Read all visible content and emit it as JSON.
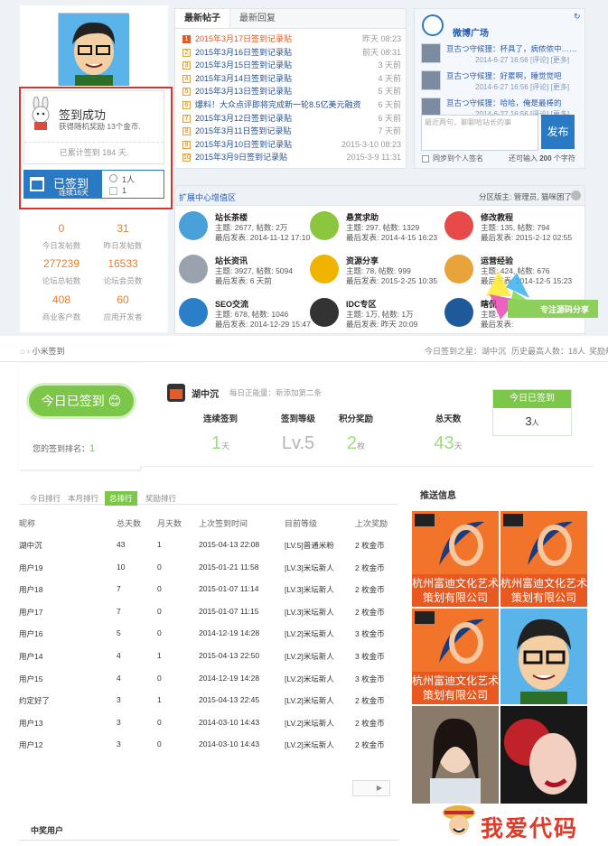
{
  "top": {
    "signin_popup": {
      "title": "签到成功",
      "sub": "获得随机奖励 13个金币.",
      "total": "已累计签到 184 天."
    },
    "signed": {
      "label": "已签到",
      "streak": "连续16天",
      "count1": "1人",
      "count2": "1"
    },
    "stats": [
      {
        "v": "0",
        "l": "今日发帖数"
      },
      {
        "v": "31",
        "l": "昨日发帖数"
      },
      {
        "v": "277239",
        "l": "论坛总帖数"
      },
      {
        "v": "16533",
        "l": "论坛会员数"
      },
      {
        "v": "408",
        "l": "商业客户数"
      },
      {
        "v": "60",
        "l": "应用开发者"
      }
    ],
    "posts_tabs": [
      "最新帖子",
      "最新回复"
    ],
    "posts": [
      {
        "n": "1",
        "t": "2015年3月17日签到记录贴",
        "d": "昨天 08:23",
        "hot": true
      },
      {
        "n": "2",
        "t": "2015年3月16日签到记录贴",
        "d": "前天 08:31"
      },
      {
        "n": "3",
        "t": "2015年3月15日签到记录贴",
        "d": "3 天前"
      },
      {
        "n": "4",
        "t": "2015年3月14日签到记录贴",
        "d": "4 天前"
      },
      {
        "n": "5",
        "t": "2015年3月13日签到记录贴",
        "d": "5 天前"
      },
      {
        "n": "6",
        "t": "爆料！大众点评即将完成新一轮8.5亿美元融资",
        "d": "6 天前"
      },
      {
        "n": "7",
        "t": "2015年3月12日签到记录贴",
        "d": "6 天前"
      },
      {
        "n": "8",
        "t": "2015年3月11日签到记录贴",
        "d": "7 天前"
      },
      {
        "n": "9",
        "t": "2015年3月10日签到记录贴",
        "d": "2015-3-10 08:23"
      },
      {
        "n": "10",
        "t": "2015年3月9日签到记录贴",
        "d": "2015-3-9 11:31"
      }
    ],
    "weibo": {
      "title": "微博广场",
      "items": [
        {
          "t": "亘古つ守候狸：杯具了，病侬侬中……",
          "d": "2014-6-27 16:56 [评论] [更多]"
        },
        {
          "t": "亘古つ守候狸：好累啊，睡觉觉吧",
          "d": "2014-6-27 16:56 [评论] [更多]"
        },
        {
          "t": "亘古つ守候狸：哈哈，俺是最棒的",
          "d": "2014-6-27 16:56 [评论] [更多]"
        }
      ],
      "placeholder": "最近两句，聊聊哈站长的事",
      "publish": "发布",
      "sync": "同步到个人签名",
      "remain": "还可输入",
      "remain_n": "200",
      "remain_unit": "个字符"
    },
    "ext": {
      "title": "扩展中心增值区",
      "moderators": "分区版主: 管理员, 猫咪困了",
      "forums": [
        {
          "name": "站长茶楼",
          "stat": "主题: 2677, 帖数: 2万",
          "last": "最后发表: 2014-11-12 17:10",
          "color": "#4aa0d8"
        },
        {
          "name": "悬赏求助",
          "stat": "主题: 297, 帖数: 1329",
          "last": "最后发表: 2014-4-15 16:23",
          "color": "#8cc63e"
        },
        {
          "name": "修改教程",
          "stat": "主题: 135, 帖数: 794",
          "last": "最后发表: 2015-2-12 02:55",
          "color": "#e84a4a"
        },
        {
          "name": "站长资讯",
          "stat": "主题: 3927, 帖数: 5094",
          "last": "最后发表: 6 天前",
          "color": "#9aa3ad"
        },
        {
          "name": "资源分享",
          "stat": "主题: 78, 帖数: 999",
          "last": "最后发表: 2015-2-25 10:35",
          "color": "#f0b400"
        },
        {
          "name": "运营经验",
          "stat": "主题: 424, 帖数: 676",
          "last": "最后发表: 2014-12-5 15:23",
          "color": "#e8a43a"
        },
        {
          "name": "SEO交流",
          "stat": "主题: 678, 帖数: 1046",
          "last": "最后发表: 2014-12-29 15:47",
          "color": "#2a7fc8"
        },
        {
          "name": "IDC专区",
          "stat": "主题: 1万, 帖数: 1万",
          "last": "最后发表: 昨天 20:09",
          "color": "#333333"
        },
        {
          "name": "瞎侃",
          "stat": "主题:",
          "last": "最后发表:",
          "color": "#1e5a9a"
        }
      ]
    },
    "watermark": "专注源码分享"
  },
  "bread": {
    "home": "小米签到",
    "right1": "今日签到之星：湖中沉",
    "right2": "历史最高人数：18人",
    "right3": "奖励规则"
  },
  "sign": {
    "button": "今日已签到 😊",
    "rank_label": "您的签到排名：",
    "rank": "1",
    "user": "湖中沉",
    "badge": "每日正能量：新添加第二条",
    "stats": [
      {
        "l": "连续签到",
        "v": "1",
        "u": "天"
      },
      {
        "l": "签到等级",
        "v": "Lv.5",
        "u": ""
      },
      {
        "l": "积分奖励",
        "v": "2",
        "u": "枚"
      },
      {
        "l": "总天数",
        "v": "43",
        "u": "天"
      }
    ],
    "today_title": "今日已签到",
    "today_count": "3",
    "today_unit": "人"
  },
  "rank": {
    "tabs": [
      "今日排行",
      "本月排行",
      "总排行",
      "奖励排行"
    ],
    "cols": [
      "昵称",
      "总天数",
      "月天数",
      "上次签到时间",
      "目前等级",
      "上次奖励"
    ],
    "rows": [
      [
        "湖中沉",
        "43",
        "1",
        "2015-04-13 22:08",
        "[LV.5]普通米粉",
        "2 枚金币"
      ],
      [
        "用户19",
        "10",
        "0",
        "2015-01-21 11:58",
        "[LV.3]米坛新人",
        "2 枚金币"
      ],
      [
        "用户18",
        "7",
        "0",
        "2015-01-07 11:14",
        "[LV.3]米坛新人",
        "2 枚金币"
      ],
      [
        "用户17",
        "7",
        "0",
        "2015-01-07 11:15",
        "[LV.3]米坛新人",
        "2 枚金币"
      ],
      [
        "用户16",
        "5",
        "0",
        "2014-12-19 14:28",
        "[LV.2]米坛新人",
        "3 枚金币"
      ],
      [
        "用户14",
        "4",
        "1",
        "2015-04-13 22:50",
        "[LV.2]米坛新人",
        "3 枚金币"
      ],
      [
        "用户15",
        "4",
        "0",
        "2014-12-19 14:28",
        "[LV.2]米坛新人",
        "3 枚金币"
      ],
      [
        "约定好了",
        "3",
        "1",
        "2015-04-13 22:45",
        "[LV.2]米坛新人",
        "2 枚金币"
      ],
      [
        "用户13",
        "3",
        "0",
        "2014-03-10 14:43",
        "[LV.2]米坛新人",
        "2 枚金币"
      ],
      [
        "用户12",
        "3",
        "0",
        "2014-03-10 14:43",
        "[LV.2]米坛新人",
        "2 枚金币"
      ]
    ],
    "footer": "中奖用户"
  },
  "recommend": {
    "title": "推送信息",
    "ad_text": "杭州富迪文化艺术策划有限公司"
  },
  "logo": "我爱代码",
  "colors": {
    "green": "#7cc64a",
    "orange": "#e87e2a",
    "blue": "#2a79c4",
    "red": "#d9332b"
  }
}
